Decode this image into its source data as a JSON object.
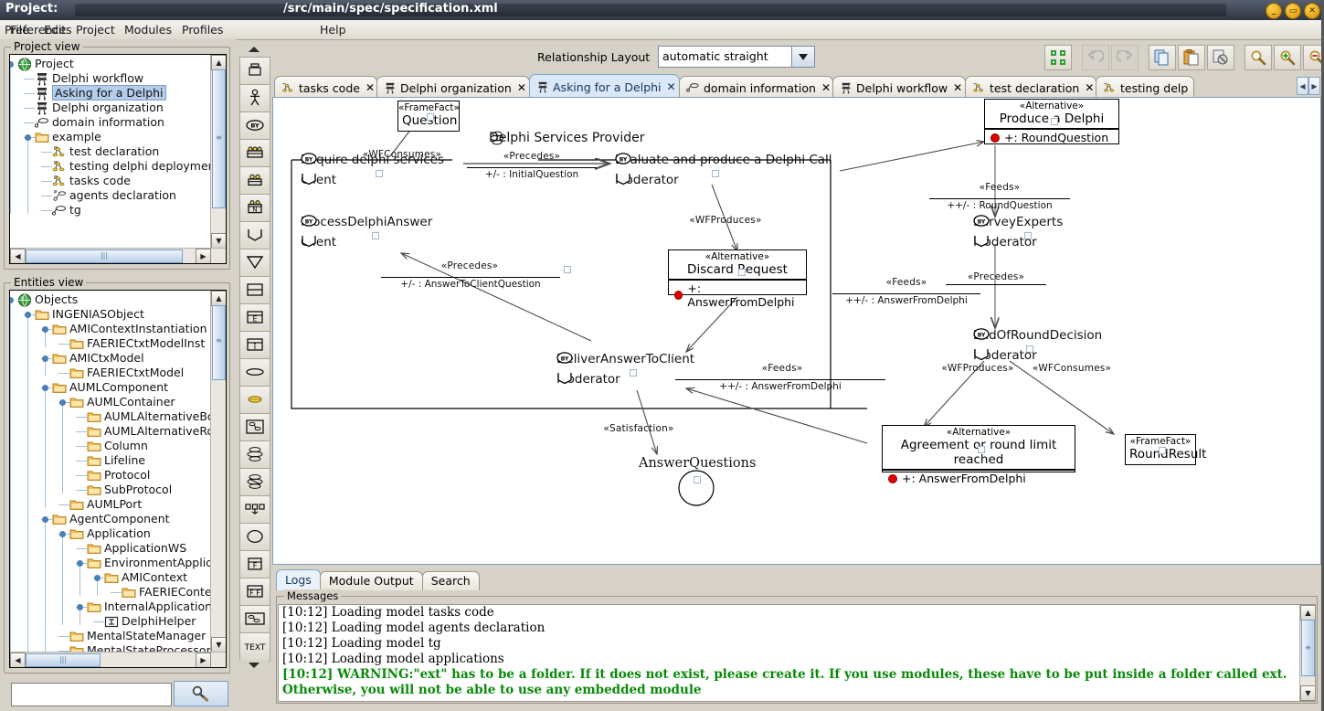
{
  "window": {
    "title_label": "Project:",
    "file_path": "/src/main/spec/specification.xml",
    "buttons": [
      {
        "name": "minimize",
        "glyph": "_"
      },
      {
        "name": "maximize",
        "glyph": "▭"
      },
      {
        "name": "close",
        "glyph": "✕"
      }
    ]
  },
  "menubar": {
    "items": [
      "File",
      "Edit",
      "Project",
      "Modules",
      "Profiles",
      "Preferences",
      "Help"
    ]
  },
  "project_view": {
    "title": "Project view",
    "items": [
      {
        "label": "Project",
        "icon": "globe-icon",
        "depth": 0,
        "selected": false
      },
      {
        "label": "Delphi workflow",
        "icon": "workflow-icon",
        "depth": 1,
        "selected": false
      },
      {
        "label": "Asking for a Delphi",
        "icon": "workflow-icon",
        "depth": 1,
        "selected": true
      },
      {
        "label": "Delphi organization",
        "icon": "workflow-icon",
        "depth": 1,
        "selected": false
      },
      {
        "label": "domain information",
        "icon": "domain-icon",
        "depth": 1,
        "selected": false
      },
      {
        "label": "example",
        "icon": "folder-icon",
        "depth": 1,
        "selected": false
      },
      {
        "label": "test declaration",
        "icon": "tasks-icon",
        "depth": 2,
        "selected": false
      },
      {
        "label": "testing delphi deploymen",
        "icon": "tasks-icon",
        "depth": 2,
        "selected": false
      },
      {
        "label": "tasks code",
        "icon": "tasks-icon",
        "depth": 2,
        "selected": false
      },
      {
        "label": "agents declaration",
        "icon": "agents-icon",
        "depth": 2,
        "selected": false
      },
      {
        "label": "tg",
        "icon": "domain-icon",
        "depth": 2,
        "selected": false
      }
    ]
  },
  "entities_view": {
    "title": "Entities view",
    "items": [
      {
        "label": "Objects",
        "icon": "globe-icon",
        "depth": 0
      },
      {
        "label": "INGENIASObject",
        "icon": "folder-icon",
        "depth": 1
      },
      {
        "label": "AMIContextInstantiation",
        "icon": "folder-icon",
        "depth": 2
      },
      {
        "label": "FAERIECtxtModelInst",
        "icon": "folder-icon",
        "depth": 3
      },
      {
        "label": "AMICtxModel",
        "icon": "folder-icon",
        "depth": 2
      },
      {
        "label": "FAERIECtxtModel",
        "icon": "folder-icon",
        "depth": 3
      },
      {
        "label": "AUMLComponent",
        "icon": "folder-icon",
        "depth": 2
      },
      {
        "label": "AUMLContainer",
        "icon": "folder-icon",
        "depth": 3
      },
      {
        "label": "AUMLAlternativeBox",
        "icon": "folder-icon",
        "depth": 4
      },
      {
        "label": "AUMLAlternativeRow",
        "icon": "folder-icon",
        "depth": 4
      },
      {
        "label": "Column",
        "icon": "folder-icon",
        "depth": 4
      },
      {
        "label": "Lifeline",
        "icon": "folder-icon",
        "depth": 4
      },
      {
        "label": "Protocol",
        "icon": "folder-icon",
        "depth": 4
      },
      {
        "label": "SubProtocol",
        "icon": "folder-icon",
        "depth": 4
      },
      {
        "label": "AUMLPort",
        "icon": "folder-icon",
        "depth": 3
      },
      {
        "label": "AgentComponent",
        "icon": "folder-icon",
        "depth": 2
      },
      {
        "label": "Application",
        "icon": "folder-icon",
        "depth": 3
      },
      {
        "label": "ApplicationWS",
        "icon": "folder-icon",
        "depth": 4
      },
      {
        "label": "EnvironmentApplica",
        "icon": "folder-icon",
        "depth": 4
      },
      {
        "label": "AMIContext",
        "icon": "folder-icon",
        "depth": 5
      },
      {
        "label": "FAERIEConte",
        "icon": "folder-icon",
        "depth": 6
      },
      {
        "label": "InternalApplication",
        "icon": "folder-icon",
        "depth": 4
      },
      {
        "label": "DelphiHelper",
        "icon": "internal-app-icon",
        "depth": 5
      },
      {
        "label": "MentalStateManager",
        "icon": "folder-icon",
        "depth": 3
      },
      {
        "label": "MentalStateProcessor",
        "icon": "folder-icon",
        "depth": 3
      }
    ]
  },
  "search": {
    "value": "",
    "placeholder": "",
    "button_icon": "magnifier-icon"
  },
  "palette": {
    "tools": [
      "scroll-up-icon",
      "agent-icon",
      "actor-icon",
      "role-icon",
      "group-icon",
      "organization-icon",
      "organization-n-icon",
      "role-goal-icon",
      "goal-icon",
      "fact-icon",
      "event-icon",
      "interaction-icon",
      "state-icon",
      "task-icon",
      "workflow-a-icon",
      "workflow-b-icon",
      "workflow-c-icon",
      "deployment-icon",
      "circle-icon",
      "frame-f-icon",
      "frame-ff-icon",
      "diagram-icon",
      "text-icon",
      "scroll-down-icon"
    ]
  },
  "editor_toolbar": {
    "relationship_layout_label": "Relationship Layout",
    "relationship_layout_value": "automatic straight",
    "buttons": [
      "arrange-icon",
      "undo-icon",
      "redo-icon",
      "copy-icon",
      "paste-icon",
      "delete-icon",
      "zoom-icon",
      "zoom-in-icon",
      "zoom-out-icon"
    ]
  },
  "tabs": [
    {
      "label": "tasks code",
      "icon": "tasks-icon",
      "active": false,
      "close": "✕"
    },
    {
      "label": "Delphi organization",
      "icon": "workflow-icon",
      "active": false,
      "close": "✕"
    },
    {
      "label": "Asking for a Delphi",
      "icon": "workflow-icon",
      "active": true,
      "close": "✕"
    },
    {
      "label": "domain information",
      "icon": "domain-icon",
      "active": false,
      "close": "✕"
    },
    {
      "label": "Delphi workflow",
      "icon": "workflow-icon",
      "active": false,
      "close": "✕"
    },
    {
      "label": "test declaration",
      "icon": "tasks-icon",
      "active": false,
      "close": "✕"
    },
    {
      "label": "testing delp",
      "icon": "tasks-icon",
      "active": false,
      "close": ""
    }
  ],
  "diagram": {
    "container_label": "Delphi Services Provider",
    "boxes": [
      {
        "id": "question",
        "stereotype": "«FrameFact»",
        "name": "Question",
        "attr": null
      },
      {
        "id": "produce-a-delphi",
        "stereotype": "«Alternative»",
        "name": "Produce a Delphi",
        "attr": "+: RoundQuestion"
      },
      {
        "id": "discard-request",
        "stereotype": "«Alternative»",
        "name": "Discard Request",
        "attr": "+: AnswerFromDelphi"
      },
      {
        "id": "agreement",
        "stereotype": "«Alternative»",
        "name": "Agreement or round limit reached",
        "attr": "+: AnswerFromDelphi"
      },
      {
        "id": "roundresult",
        "stereotype": "«FrameFact»",
        "name": "RoundResult",
        "attr": null
      }
    ],
    "tasks": [
      {
        "id": "require-delphi-services",
        "name": "Require delphi services",
        "actor": "Client"
      },
      {
        "id": "process-delphi-answer",
        "name": "ProcessDelphiAnswer",
        "actor": "Client"
      },
      {
        "id": "evaluate-produce-call",
        "name": "Evaluate and produce a Delphi Call",
        "actor": "Moderator"
      },
      {
        "id": "survey-experts",
        "name": "SurveyExperts",
        "actor": "Moderator"
      },
      {
        "id": "end-of-round-decision",
        "name": "EndOfRoundDecision",
        "actor": "Moderator"
      },
      {
        "id": "deliver-answer-to-client",
        "name": "DeliverAnswerToClient",
        "actor": "Moderator"
      }
    ],
    "goal": {
      "id": "answer-questions",
      "name": "AnswerQuestions"
    },
    "edges": [
      {
        "id": "e-wfconsumes-question",
        "label": "«WFConsumes»",
        "role": null
      },
      {
        "id": "e-precedes-initialquestion",
        "label": "«Precedes»",
        "role": "+/- :  InitialQuestion"
      },
      {
        "id": "e-wfproduces-produce",
        "label": "«WFProduces»",
        "role": null
      },
      {
        "id": "e-feeds-roundquestion",
        "label": "«Feeds»",
        "role": "++/- :  RoundQuestion"
      },
      {
        "id": "e-precedes-survey-end",
        "label": "«Precedes»",
        "role": null
      },
      {
        "id": "e-wfproduces-discard",
        "label": "«WFProduces»",
        "role": null
      },
      {
        "id": "e-feeds-discard",
        "label": "«Feeds»",
        "role": "++/- :  AnswerFromDelphi"
      },
      {
        "id": "e-precedes-answertoclient",
        "label": "«Precedes»",
        "role": "+/- :  AnswerToClientQuestion"
      },
      {
        "id": "e-wfproduces-agreement",
        "label": "«WFProduces»",
        "role": null
      },
      {
        "id": "e-wfconsumes-roundresult",
        "label": "«WFConsumes»",
        "role": null
      },
      {
        "id": "e-feeds-agreement",
        "label": "«Feeds»",
        "role": "++/- :  AnswerFromDelphi"
      },
      {
        "id": "e-satisfaction",
        "label": "«Satisfaction»",
        "role": null
      }
    ]
  },
  "log_panel": {
    "tabs": [
      {
        "label": "Logs",
        "active": true
      },
      {
        "label": "Module Output",
        "active": false
      },
      {
        "label": "Search",
        "active": false
      }
    ],
    "messages_title": "Messages",
    "lines": [
      {
        "text": "[10:12] Loading model tasks code",
        "warn": false
      },
      {
        "text": "[10:12] Loading model agents declaration",
        "warn": false
      },
      {
        "text": "[10:12] Loading model tg",
        "warn": false
      },
      {
        "text": "[10:12] Loading model applications",
        "warn": false
      },
      {
        "text": "[10:12] WARNING:\"ext\" has to be a folder. If it does not exist, please create it. If you use modules, these have to be put inside a folder called ext. Otherwise, you will not be able to use any embedded module",
        "warn": true
      }
    ]
  },
  "colors": {
    "selection": "#b4cdea",
    "warning": "#0a8a0a",
    "active_tab": "#d9e7f6",
    "chrome": "#d6d2c8",
    "attribute_dot": "#e00000"
  }
}
